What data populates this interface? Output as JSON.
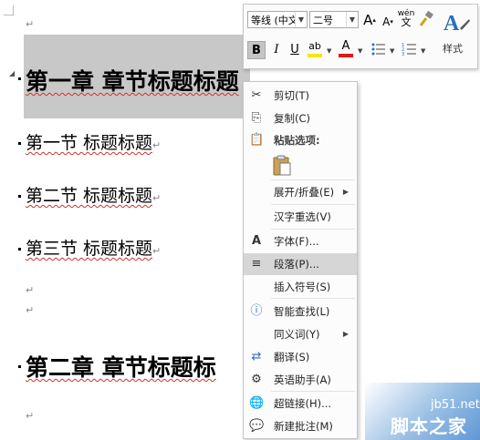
{
  "document": {
    "chapter1": "第一章  章节标题标题",
    "section1": "第一节  标题标题",
    "section2": "第二节  标题标题",
    "section3": "第三节  标题标题",
    "chapter2": "第二章  章节标题标",
    "para_mark": "↵"
  },
  "toolbar": {
    "font_name": "等线 (中文",
    "font_size": "二号",
    "grow_font": "A",
    "shrink_font": "A",
    "phonetic_top": "wén",
    "phonetic_bottom": "文",
    "bold": "B",
    "italic": "I",
    "underline": "U",
    "highlight": "ab",
    "font_color": "A",
    "styles_label": "样式",
    "highlight_color": "#f5e800",
    "font_color_value": "#e0161a"
  },
  "menu": {
    "cut": "剪切(T)",
    "copy": "复制(C)",
    "paste_options": "粘贴选项:",
    "expand_collapse": "展开/折叠(E)",
    "reconvert": "汉字重选(V)",
    "font": "字体(F)...",
    "paragraph": "段落(P)...",
    "insert_symbol": "插入符号(S)",
    "smart_lookup": "智能查找(L)",
    "synonyms": "同义词(Y)",
    "translate": "翻译(S)",
    "english_assistant": "英语助手(A)",
    "hyperlink": "超链接(H)...",
    "new_comment": "新建批注(M)"
  },
  "watermark": {
    "site": "jb51.net",
    "brand": "脚本之家"
  }
}
